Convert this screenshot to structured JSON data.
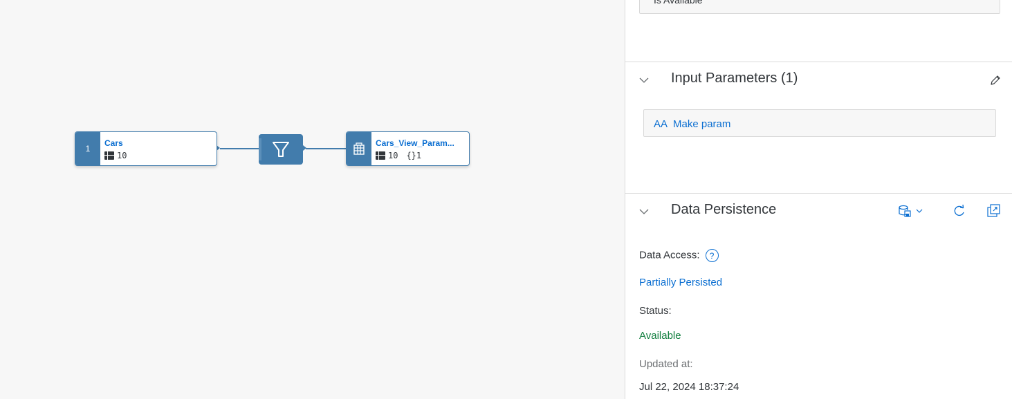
{
  "canvas": {
    "nodes": [
      {
        "id": "cars",
        "index": "1",
        "title": "Cars",
        "columns": "10"
      },
      {
        "id": "filter",
        "icon": "filter-icon"
      },
      {
        "id": "view",
        "icon": "view-grid-icon",
        "title": "Cars_View_Param...",
        "columns": "10",
        "params": "{}1"
      }
    ]
  },
  "panel": {
    "previous_box_label": "Is Available",
    "input_parameters": {
      "title": "Input Parameters (1)",
      "edit_icon": "pencil-icon",
      "params": [
        {
          "type_icon": "AA",
          "label": "Make param"
        }
      ]
    },
    "data_persistence": {
      "title": "Data Persistence",
      "data_access_label": "Data Access:",
      "help_icon": "?",
      "data_access_value": "Partially Persisted",
      "status_label": "Status:",
      "status_value": "Available",
      "updated_label": "Updated at:",
      "updated_value": "Jul 22, 2024 18:37:24"
    }
  },
  "colors": {
    "accent": "#427cac",
    "link": "#0a6ed1",
    "success": "#107e3e",
    "canvas_bg": "#f7f7f7"
  }
}
